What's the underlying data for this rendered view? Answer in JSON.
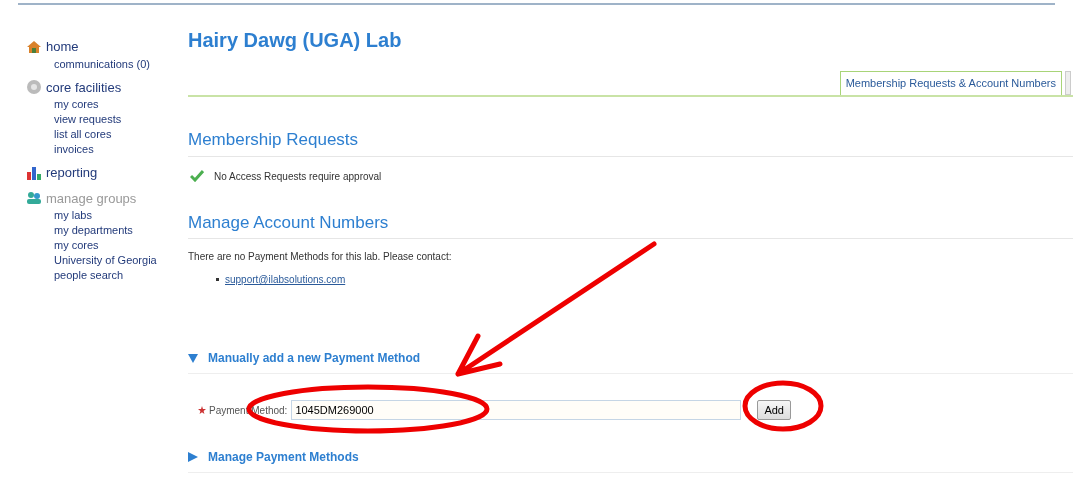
{
  "sidebar": {
    "groups": [
      {
        "kind": "home",
        "label": "home",
        "disabled": false,
        "items": [
          "communications (0)"
        ]
      },
      {
        "kind": "gear",
        "label": "core facilities",
        "disabled": false,
        "items": [
          "my cores",
          "view requests",
          "list all cores",
          "invoices"
        ]
      },
      {
        "kind": "chart",
        "label": "reporting",
        "disabled": false
      },
      {
        "kind": "people",
        "label": "manage groups",
        "disabled": true,
        "items": [
          "my labs",
          "my departments",
          "my cores",
          "University of Georgia",
          "people search"
        ]
      }
    ]
  },
  "page_title": "Hairy Dawg (UGA) Lab",
  "tabs": [
    {
      "label": "Membership Requests & Account Numbers",
      "selected": true
    }
  ],
  "membership": {
    "heading": "Membership Requests",
    "status": "No Access Requests require approval"
  },
  "accounts": {
    "heading": "Manage Account Numbers",
    "message": "There are no Payment Methods for this lab. Please contact:",
    "contacts": [
      "support@ilabsolutions.com"
    ]
  },
  "add_section": {
    "title": "Manually add a new Payment Method",
    "expanded": true,
    "field_label": "Payment Method:",
    "required": true,
    "value": "1045DM269000",
    "button": "Add"
  },
  "manage_section": {
    "title": "Manage Payment Methods",
    "expanded": false
  }
}
